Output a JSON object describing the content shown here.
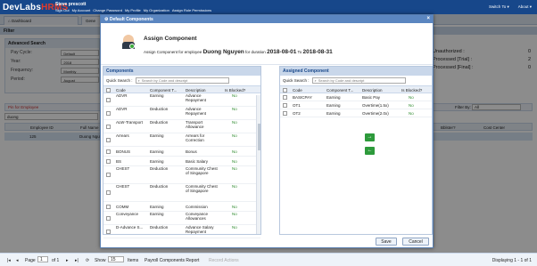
{
  "header": {
    "logo": {
      "pre": "DevLabs",
      "brand": "HRMS"
    },
    "user_name": "Steve prescott",
    "links": [
      "Sign Out",
      "My Account",
      "Change Password",
      "My Profile",
      "My Organization",
      "Assign Role Permissions"
    ],
    "switch_to": "Switch To",
    "about": "About"
  },
  "tabs": [
    "Dashboard",
    "Gene"
  ],
  "filter_title": "Filter",
  "advanced_search": {
    "title": "Advanced Search",
    "fields": [
      {
        "label": "Pay Cycle:",
        "value": "Default"
      },
      {
        "label": "Year:",
        "value": "2018"
      },
      {
        "label": "Frequency:",
        "value": "Monthly"
      },
      {
        "label": "Period:",
        "value": "August"
      }
    ]
  },
  "status_summary": [
    {
      "label": "Unauthorized :",
      "value": "0"
    },
    {
      "label": "Processed [Trial] :",
      "value": "2"
    },
    {
      "label": "Processed [Final] :",
      "value": "0"
    }
  ],
  "grid": {
    "toolbar": "Pin for Employee",
    "search_value": "duong",
    "filter_by": "Filter By:",
    "filter_value": "All",
    "headers": [
      "Employee ID",
      "Full Name",
      "Bblster?",
      "Cost Center"
    ],
    "rows": [
      {
        "id": "125",
        "name": "Duong Nguyen"
      }
    ]
  },
  "footer": {
    "page_label": "Page",
    "page": "1",
    "of": "of 1",
    "show_label": "Show",
    "show_value": "15",
    "items": "Items",
    "report": "Payroll Components Report",
    "record": "Record Actions",
    "displaying": "Displaying 1 - 1 of 1"
  },
  "dialog": {
    "title": "Default Components",
    "heading": "Assign Component",
    "sub_prefix": "Assign Component for employee",
    "employee": "Duong Nguyen",
    "for_duration": "for duration",
    "from": "2018-08-01",
    "to_label": "To",
    "to": "2018-08-31",
    "save": "Save",
    "cancel": "Cancel",
    "move_right": "→",
    "move_left": "←",
    "left": {
      "title": "Components",
      "quick_search": "Quick Search :",
      "placeholder": "Search by Code and descript",
      "headers": [
        "Code",
        "Component T...",
        "Description",
        "Is Blocked?"
      ],
      "rows": [
        {
          "code": "ADVR",
          "type": "Earning",
          "desc": "Advance Repayment",
          "blocked": "No"
        },
        {
          "code": "ADVR",
          "type": "Deduction",
          "desc": "Advance Repayment",
          "blocked": "No"
        },
        {
          "code": "ALW-Transport",
          "type": "Deduction",
          "desc": "Transport Allowance",
          "blocked": "No"
        },
        {
          "code": "Arrears",
          "type": "Earning",
          "desc": "Arrears for Correction",
          "blocked": "No"
        },
        {
          "code": "BONUS",
          "type": "Earning",
          "desc": "Bonus",
          "blocked": "No"
        },
        {
          "code": "BS",
          "type": "Earning",
          "desc": "Basic Salary",
          "blocked": "No"
        },
        {
          "code": "CHEST",
          "type": "Deduction",
          "desc": "Community Chest of Singapore",
          "blocked": "No"
        },
        {
          "code": "CHEST",
          "type": "Deduction",
          "desc": "Community Chest of Singapore",
          "blocked": "No"
        },
        {
          "code": "COMM",
          "type": "Earning",
          "desc": "Commission",
          "blocked": "No"
        },
        {
          "code": "Conveyance",
          "type": "Earning",
          "desc": "Conveyance Allowances",
          "blocked": "No"
        },
        {
          "code": "D-Advance S...",
          "type": "Deduction",
          "desc": "Advance Salary Repayment",
          "blocked": "No"
        }
      ]
    },
    "right": {
      "title": "Assigned Component",
      "quick_search": "Quick Search :",
      "placeholder": "Search by Code and descript",
      "headers": [
        "Code",
        "Component T...",
        "Description",
        "Is Blocked?"
      ],
      "rows": [
        {
          "code": "BASICPAY",
          "type": "Earning",
          "desc": "Basic Pay",
          "blocked": "No"
        },
        {
          "code": "OT1",
          "type": "Earning",
          "desc": "Overtime(1.5x)",
          "blocked": "No"
        },
        {
          "code": "OT2",
          "type": "Earning",
          "desc": "Overtime(2.0x)",
          "blocked": "No"
        }
      ]
    }
  }
}
